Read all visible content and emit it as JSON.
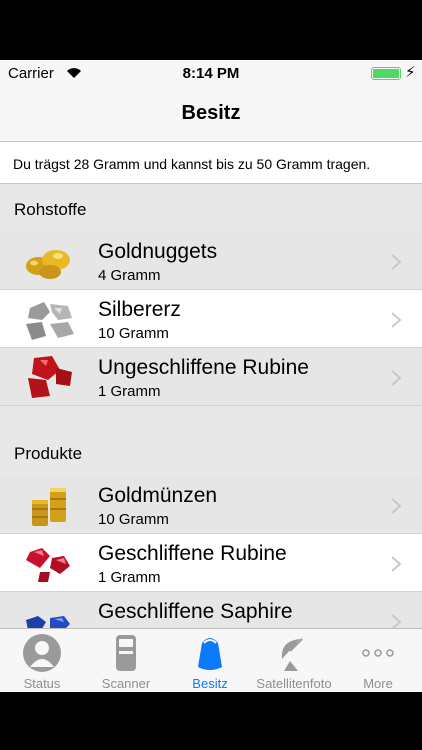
{
  "status_bar": {
    "carrier": "Carrier",
    "time": "8:14 PM"
  },
  "nav": {
    "title": "Besitz"
  },
  "info_text": "Du trägst 28 Gramm und kannst bis zu 50 Gramm tragen.",
  "sections": [
    {
      "title": "Rohstoffe",
      "items": [
        {
          "name": "Goldnuggets",
          "amount": "4 Gramm",
          "icon": "gold-nugget-icon"
        },
        {
          "name": "Silbererz",
          "amount": "10 Gramm",
          "icon": "silver-ore-icon"
        },
        {
          "name": "Ungeschliffene Rubine",
          "amount": "1 Gramm",
          "icon": "raw-ruby-icon"
        }
      ]
    },
    {
      "title": "Produkte",
      "items": [
        {
          "name": "Goldmünzen",
          "amount": "10 Gramm",
          "icon": "gold-coins-icon"
        },
        {
          "name": "Geschliffene Rubine",
          "amount": "1 Gramm",
          "icon": "cut-ruby-icon"
        },
        {
          "name": "Geschliffene Saphire",
          "amount": "",
          "icon": "cut-sapphire-icon"
        }
      ]
    }
  ],
  "tabs": [
    {
      "label": "Status",
      "icon": "person-icon"
    },
    {
      "label": "Scanner",
      "icon": "scanner-icon"
    },
    {
      "label": "Besitz",
      "icon": "backpack-icon"
    },
    {
      "label": "Satellitenfoto",
      "icon": "satellite-dish-icon"
    },
    {
      "label": "More",
      "icon": "more-icon"
    }
  ],
  "colors": {
    "accent": "#0a7aff",
    "battery": "#4cd964",
    "inactive_tab": "#8e8e93"
  }
}
